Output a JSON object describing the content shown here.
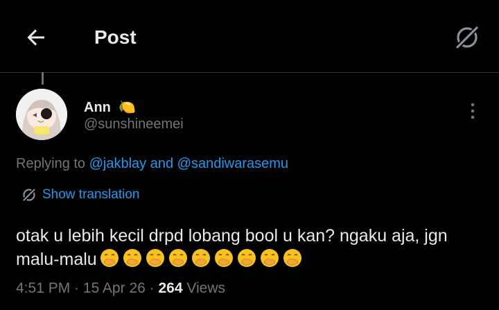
{
  "header": {
    "title": "Post",
    "back_icon": "arrow-left-icon",
    "grok_icon": "grok-icon"
  },
  "author": {
    "name": "Ann",
    "name_emoji": "🍋",
    "handle": "@sunshineemei"
  },
  "reply": {
    "prefix": "Replying to ",
    "mention1": "@jakblay",
    "connector": " and ",
    "mention2": "@sandiwarasemu"
  },
  "translate": {
    "label": "Show translation"
  },
  "tweet": {
    "text": "otak u lebih kecil drpd lobang bool u kan? ngaku aja, jgn malu-malu",
    "emoji": "🤭",
    "emoji_count": 9
  },
  "meta": {
    "time": "4:51 PM",
    "sep": " · ",
    "date": "15 Apr 26",
    "views_count": "264",
    "views_label": " Views"
  },
  "colors": {
    "accent": "#1d9bf0",
    "text": "#e7e9ea",
    "muted": "#71767b",
    "bg": "#000000",
    "divider": "#2f3336"
  }
}
